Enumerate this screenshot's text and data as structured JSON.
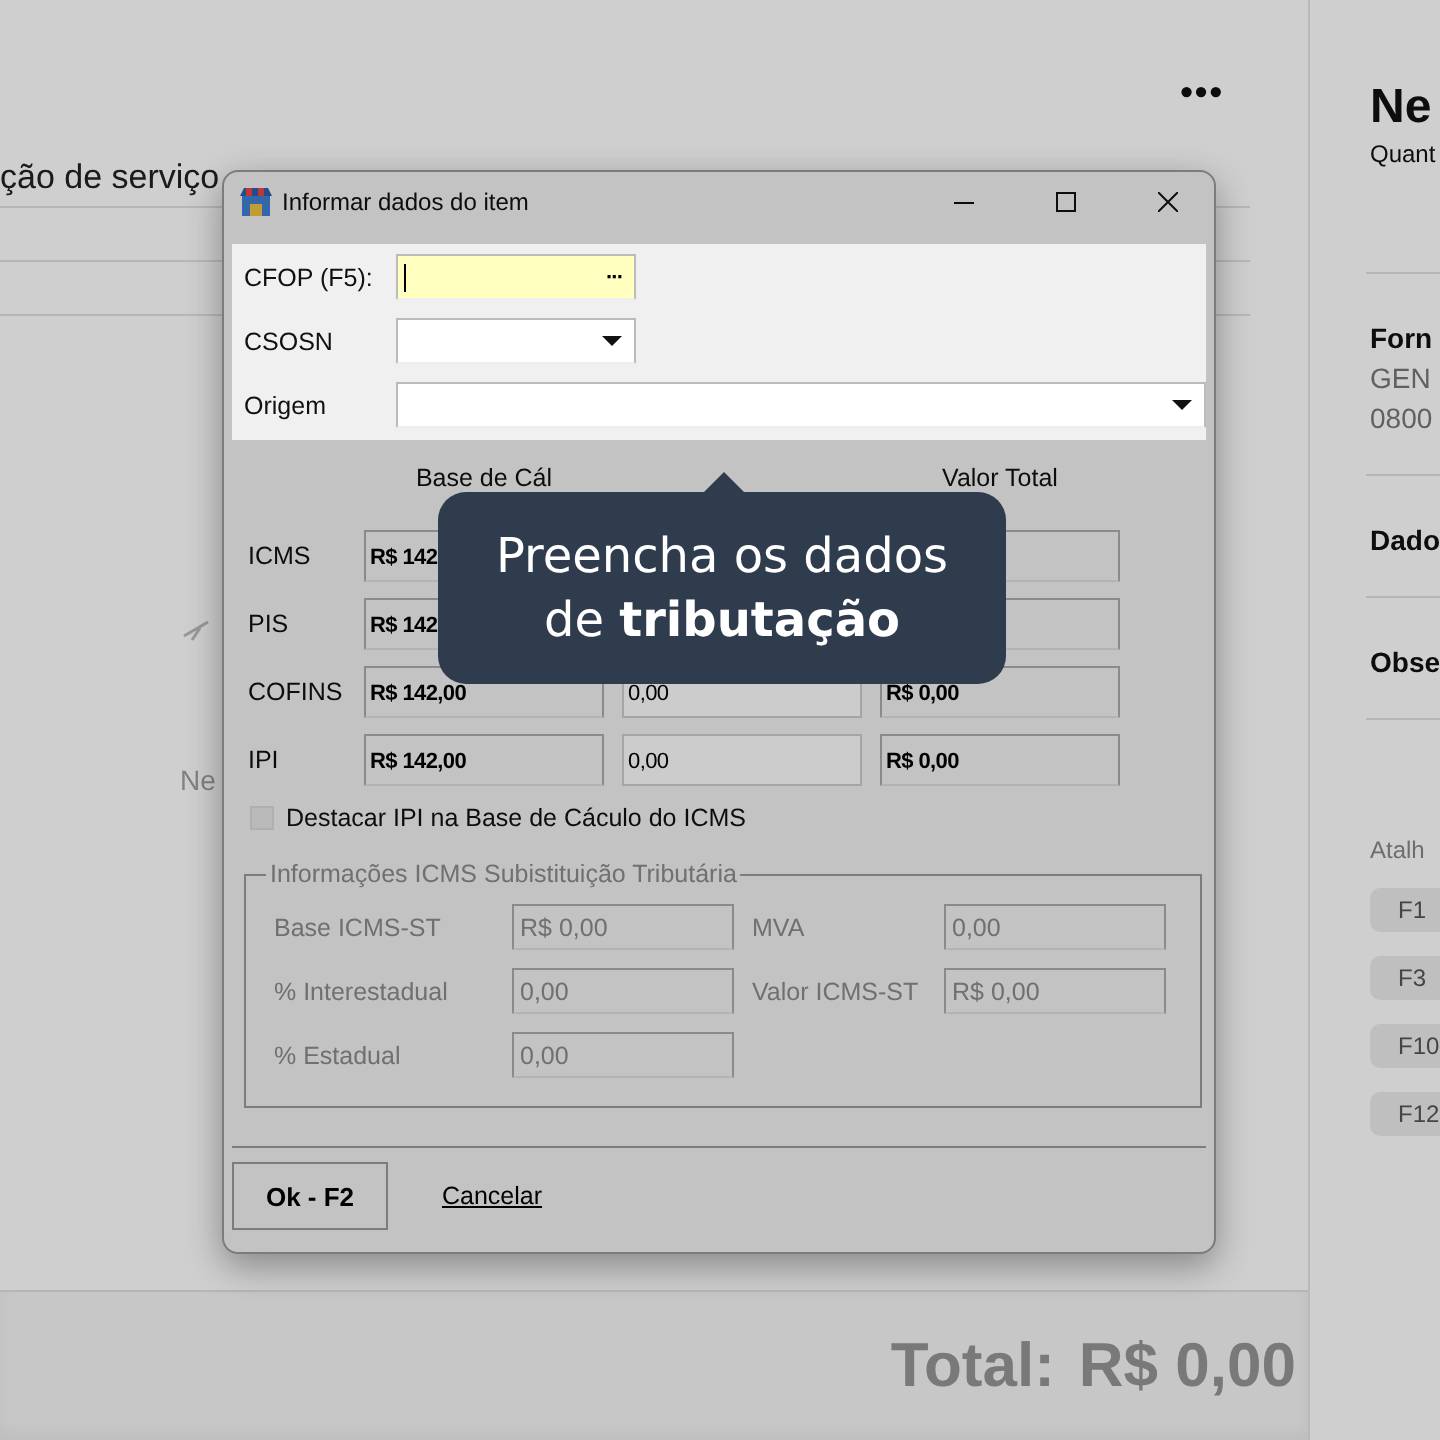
{
  "background": {
    "more_button": "•••",
    "section_text": "ção de serviço",
    "empty_text": "Ne",
    "total_label": "Total:",
    "total_value": "R$ 0,00",
    "side_panel": {
      "title": "Ne",
      "subtitle": "Quant",
      "sections": [
        {
          "title": "Forn",
          "lines": [
            "GEN",
            "0800"
          ]
        },
        {
          "title": "Dado"
        },
        {
          "title": "Obse"
        }
      ],
      "shortcuts_title": "Atalh",
      "shortcuts": [
        "F1",
        "F3",
        "F10",
        "F12"
      ]
    }
  },
  "dialog": {
    "title": "Informar dados do item",
    "fields": [
      {
        "kind": "lookup",
        "label": "CFOP (F5):",
        "button": "···",
        "focused": true
      },
      {
        "kind": "short_dropdown",
        "label": "CSOSN",
        "focused": false
      },
      {
        "kind": "long_dropdown",
        "label": "Origem",
        "focused": false
      }
    ],
    "tax_headers": {
      "base": "Base de Cál",
      "total": "Valor Total"
    },
    "tax_rows": [
      {
        "label": "ICMS",
        "base": "R$ 142"
      },
      {
        "label": "PIS",
        "base": "R$ 142"
      },
      {
        "label": "COFINS",
        "base": "R$ 142,00",
        "rate": "0,00",
        "total": "R$ 0,00"
      },
      {
        "label": "IPI",
        "base": "R$ 142,00",
        "rate": "0,00",
        "total": "R$ 0,00"
      }
    ],
    "ipi_checkbox": {
      "label": "Destacar IPI na Base de Cáculo do ICMS",
      "checked": false,
      "disabled": true
    },
    "st_group": {
      "title": "Informações ICMS Subistituição Tributária",
      "disabled": true,
      "fields": [
        {
          "label": "Base ICMS-ST",
          "value": "R$ 0,00"
        },
        {
          "label": "MVA",
          "value": "0,00"
        },
        {
          "label": "% Interestadual",
          "value": "0,00"
        },
        {
          "label": "Valor ICMS-ST",
          "value": "R$ 0,00"
        },
        {
          "label": "% Estadual",
          "value": "0,00"
        }
      ]
    },
    "ok_button": "Ok - F2",
    "cancel_link": "Cancelar"
  },
  "hint": {
    "lines": [
      "Preencha os dados",
      "de **tributação**"
    ]
  }
}
